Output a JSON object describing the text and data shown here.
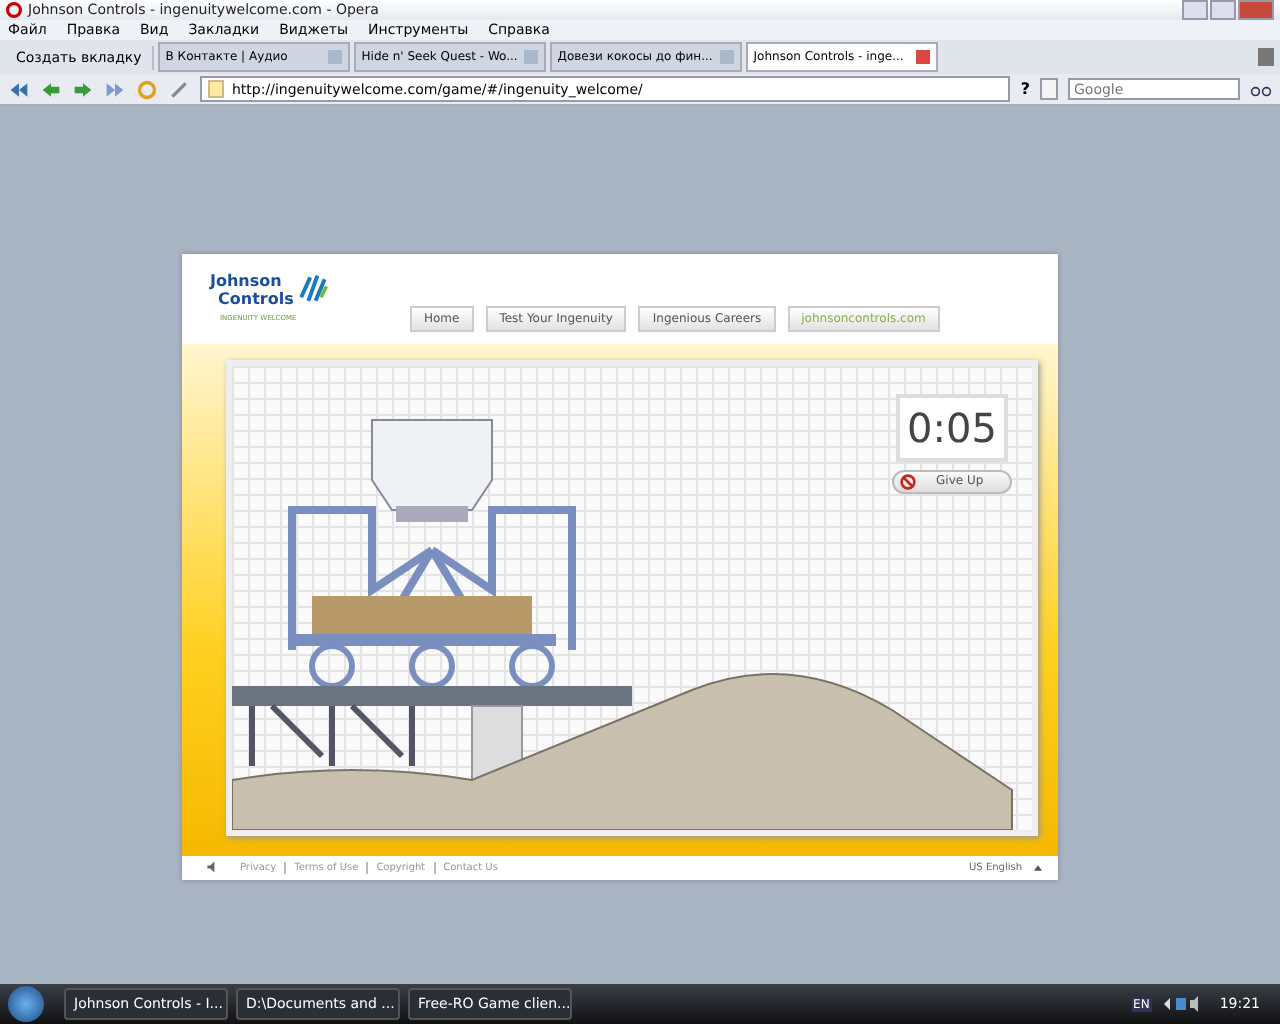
{
  "window": {
    "title": "Johnson Controls - ingenuitywelcome.com - Opera"
  },
  "menu": [
    "Файл",
    "Правка",
    "Вид",
    "Закладки",
    "Виджеты",
    "Инструменты",
    "Справка"
  ],
  "new_tab": "Создать вкладку",
  "tabs": [
    {
      "label": "В Контакте | Аудио",
      "selected": false
    },
    {
      "label": "Hide n' Seek Quest - Wo...",
      "selected": false
    },
    {
      "label": "Довези кокосы до фин...",
      "selected": false
    },
    {
      "label": "Johnson Controls - inge...",
      "selected": true
    }
  ],
  "address": "http://ingenuitywelcome.com/game/#/ingenuity_welcome/",
  "help": "?",
  "search": {
    "placeholder": "Google"
  },
  "site": {
    "logo_line1": "Johnson",
    "logo_line2": "Controls",
    "tagline": "INGENUITY WELCOME",
    "nav": [
      {
        "label": "Home",
        "kind": "normal"
      },
      {
        "label": "Test Your Ingenuity",
        "kind": "normal"
      },
      {
        "label": "Ingenious Careers",
        "kind": "normal"
      },
      {
        "label": "johnsoncontrols.com",
        "kind": "external"
      }
    ],
    "timer": "0:05",
    "give_up": "Give Up",
    "footer_links": [
      "Privacy",
      "Terms of Use",
      "Copyright",
      "Contact Us"
    ],
    "language": "US English"
  },
  "taskbar": {
    "items": [
      "Johnson Controls - I...",
      "D:\\Documents and ...",
      "Free-RO Game clien..."
    ],
    "lang": "EN",
    "clock": "19:21"
  }
}
